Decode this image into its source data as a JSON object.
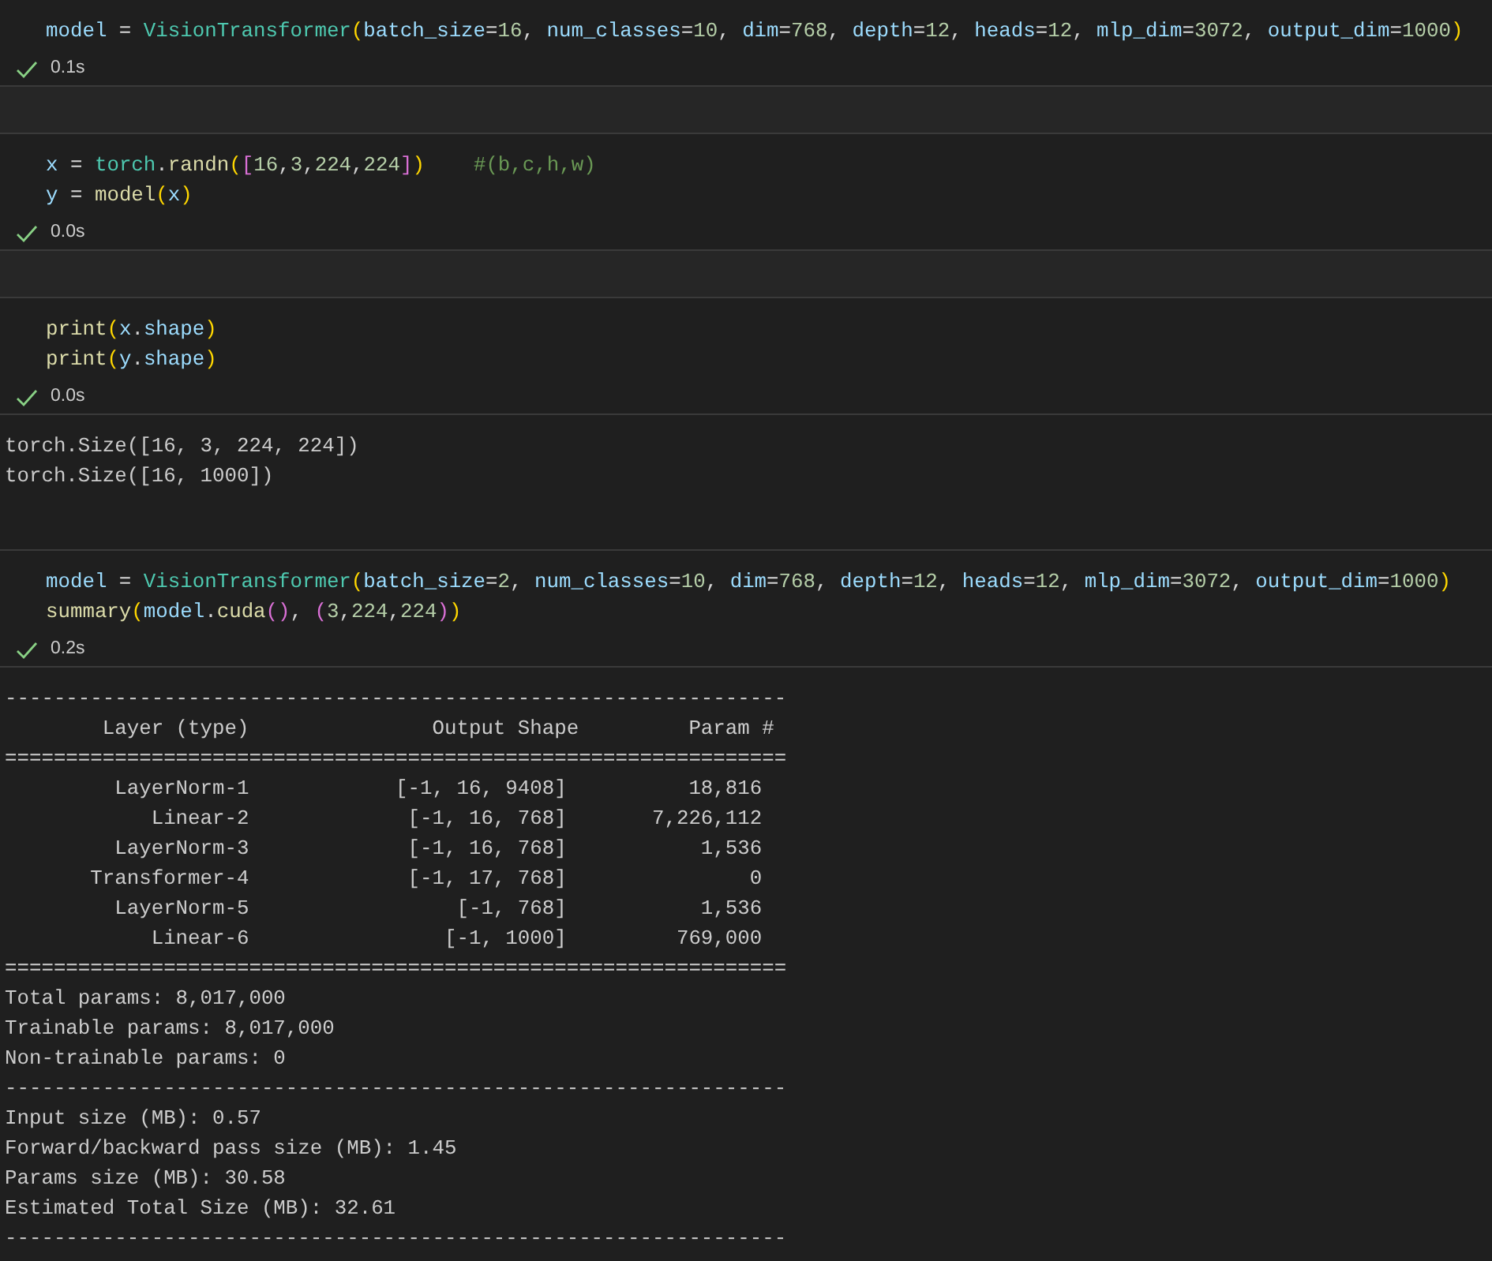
{
  "cells": [
    {
      "code": [
        [
          {
            "kind": "var",
            "text": "model"
          },
          {
            "kind": "op",
            "text": " = "
          },
          {
            "kind": "class",
            "text": "VisionTransformer"
          },
          {
            "kind": "p1",
            "text": "("
          },
          {
            "kind": "var",
            "text": "batch_size"
          },
          {
            "kind": "op",
            "text": "="
          },
          {
            "kind": "num",
            "text": "16"
          },
          {
            "kind": "op",
            "text": ", "
          },
          {
            "kind": "var",
            "text": "num_classes"
          },
          {
            "kind": "op",
            "text": "="
          },
          {
            "kind": "num",
            "text": "10"
          },
          {
            "kind": "op",
            "text": ", "
          },
          {
            "kind": "var",
            "text": "dim"
          },
          {
            "kind": "op",
            "text": "="
          },
          {
            "kind": "num",
            "text": "768"
          },
          {
            "kind": "op",
            "text": ", "
          },
          {
            "kind": "var",
            "text": "depth"
          },
          {
            "kind": "op",
            "text": "="
          },
          {
            "kind": "num",
            "text": "12"
          },
          {
            "kind": "op",
            "text": ", "
          },
          {
            "kind": "var",
            "text": "heads"
          },
          {
            "kind": "op",
            "text": "="
          },
          {
            "kind": "num",
            "text": "12"
          },
          {
            "kind": "op",
            "text": ", "
          },
          {
            "kind": "var",
            "text": "mlp_dim"
          },
          {
            "kind": "op",
            "text": "="
          },
          {
            "kind": "num",
            "text": "3072"
          },
          {
            "kind": "op",
            "text": ", "
          },
          {
            "kind": "var",
            "text": "output_dim"
          },
          {
            "kind": "op",
            "text": "="
          },
          {
            "kind": "num",
            "text": "1000"
          },
          {
            "kind": "p1",
            "text": ")"
          }
        ]
      ],
      "time": "0.1s"
    },
    {
      "code": [
        [
          {
            "kind": "var",
            "text": "x"
          },
          {
            "kind": "op",
            "text": " = "
          },
          {
            "kind": "class",
            "text": "torch"
          },
          {
            "kind": "op",
            "text": "."
          },
          {
            "kind": "func",
            "text": "randn"
          },
          {
            "kind": "p1",
            "text": "("
          },
          {
            "kind": "p2",
            "text": "["
          },
          {
            "kind": "num",
            "text": "16"
          },
          {
            "kind": "op",
            "text": ","
          },
          {
            "kind": "num",
            "text": "3"
          },
          {
            "kind": "op",
            "text": ","
          },
          {
            "kind": "num",
            "text": "224"
          },
          {
            "kind": "op",
            "text": ","
          },
          {
            "kind": "num",
            "text": "224"
          },
          {
            "kind": "p2",
            "text": "]"
          },
          {
            "kind": "p1",
            "text": ")"
          },
          {
            "kind": "comment",
            "text": "#(b,c,h,w)"
          }
        ],
        [
          {
            "kind": "var",
            "text": "y"
          },
          {
            "kind": "op",
            "text": " = "
          },
          {
            "kind": "func",
            "text": "model"
          },
          {
            "kind": "p1",
            "text": "("
          },
          {
            "kind": "var",
            "text": "x"
          },
          {
            "kind": "p1",
            "text": ")"
          }
        ]
      ],
      "time": "0.0s"
    },
    {
      "code": [
        [
          {
            "kind": "func",
            "text": "print"
          },
          {
            "kind": "p1",
            "text": "("
          },
          {
            "kind": "var",
            "text": "x"
          },
          {
            "kind": "op",
            "text": "."
          },
          {
            "kind": "var",
            "text": "shape"
          },
          {
            "kind": "p1",
            "text": ")"
          }
        ],
        [
          {
            "kind": "func",
            "text": "print"
          },
          {
            "kind": "p1",
            "text": "("
          },
          {
            "kind": "var",
            "text": "y"
          },
          {
            "kind": "op",
            "text": "."
          },
          {
            "kind": "var",
            "text": "shape"
          },
          {
            "kind": "p1",
            "text": ")"
          }
        ]
      ],
      "time": "0.0s",
      "output": [
        "torch.Size([16, 3, 224, 224])",
        "torch.Size([16, 1000])"
      ]
    },
    {
      "code": [
        [
          {
            "kind": "var",
            "text": "model"
          },
          {
            "kind": "op",
            "text": " = "
          },
          {
            "kind": "class",
            "text": "VisionTransformer"
          },
          {
            "kind": "p1",
            "text": "("
          },
          {
            "kind": "var",
            "text": "batch_size"
          },
          {
            "kind": "op",
            "text": "="
          },
          {
            "kind": "num",
            "text": "2"
          },
          {
            "kind": "op",
            "text": ", "
          },
          {
            "kind": "var",
            "text": "num_classes"
          },
          {
            "kind": "op",
            "text": "="
          },
          {
            "kind": "num",
            "text": "10"
          },
          {
            "kind": "op",
            "text": ", "
          },
          {
            "kind": "var",
            "text": "dim"
          },
          {
            "kind": "op",
            "text": "="
          },
          {
            "kind": "num",
            "text": "768"
          },
          {
            "kind": "op",
            "text": ", "
          },
          {
            "kind": "var",
            "text": "depth"
          },
          {
            "kind": "op",
            "text": "="
          },
          {
            "kind": "num",
            "text": "12"
          },
          {
            "kind": "op",
            "text": ", "
          },
          {
            "kind": "var",
            "text": "heads"
          },
          {
            "kind": "op",
            "text": "="
          },
          {
            "kind": "num",
            "text": "12"
          },
          {
            "kind": "op",
            "text": ", "
          },
          {
            "kind": "var",
            "text": "mlp_dim"
          },
          {
            "kind": "op",
            "text": "="
          },
          {
            "kind": "num",
            "text": "3072"
          },
          {
            "kind": "op",
            "text": ", "
          },
          {
            "kind": "var",
            "text": "output_dim"
          },
          {
            "kind": "op",
            "text": "="
          },
          {
            "kind": "num",
            "text": "1000"
          },
          {
            "kind": "p1",
            "text": ")"
          }
        ],
        [
          {
            "kind": "func",
            "text": "summary"
          },
          {
            "kind": "p1",
            "text": "("
          },
          {
            "kind": "var",
            "text": "model"
          },
          {
            "kind": "op",
            "text": "."
          },
          {
            "kind": "func",
            "text": "cuda"
          },
          {
            "kind": "p2",
            "text": "()"
          },
          {
            "kind": "op",
            "text": ", "
          },
          {
            "kind": "p2",
            "text": "("
          },
          {
            "kind": "num",
            "text": "3"
          },
          {
            "kind": "op",
            "text": ","
          },
          {
            "kind": "num",
            "text": "224"
          },
          {
            "kind": "op",
            "text": ","
          },
          {
            "kind": "num",
            "text": "224"
          },
          {
            "kind": "p2",
            "text": ")"
          },
          {
            "kind": "p1",
            "text": ")"
          }
        ]
      ],
      "time": "0.2s",
      "output": [
        "----------------------------------------------------------------",
        "        Layer (type)               Output Shape         Param #",
        "================================================================",
        "         LayerNorm-1            [-1, 16, 9408]          18,816",
        "            Linear-2             [-1, 16, 768]       7,226,112",
        "         LayerNorm-3             [-1, 16, 768]           1,536",
        "       Transformer-4             [-1, 17, 768]               0",
        "         LayerNorm-5                 [-1, 768]           1,536",
        "            Linear-6                [-1, 1000]         769,000",
        "================================================================",
        "Total params: 8,017,000",
        "Trainable params: 8,017,000",
        "Non-trainable params: 0",
        "----------------------------------------------------------------",
        "Input size (MB): 0.57",
        "Forward/backward pass size (MB): 1.45",
        "Params size (MB): 30.58",
        "Estimated Total Size (MB): 32.61",
        "----------------------------------------------------------------"
      ]
    }
  ]
}
